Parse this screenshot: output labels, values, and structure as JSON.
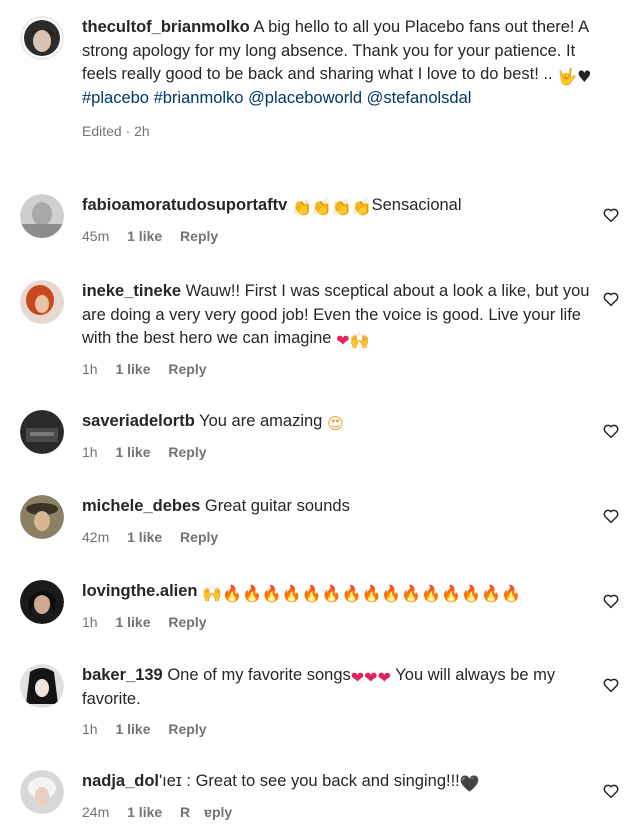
{
  "caption": {
    "username": "thecultof_brianmolko",
    "text": "A big hello to all you Placebo fans out there! A strong apology for my long absence. Thank you for your patience. It feels really good to be back and sharing what I love to do best! ..",
    "emojis": "🤟♥",
    "tags": [
      "#placebo",
      "#brianmolko",
      "@placeboworld",
      "@stefanolsdal"
    ],
    "meta": "Edited · 2h"
  },
  "comments": [
    {
      "username": "fabioamoratudosuportaftv",
      "before": "",
      "emojis": "👏👏👏👏",
      "after": "Sensacional",
      "time": "45m",
      "likes": "1 like",
      "reply": "Reply"
    },
    {
      "username": "ineke_tineke",
      "before": "Wauw!! First I was sceptical about a look a like, but you are doing a very very good job! Even the voice is good. Live your life with the best hero we can imagine",
      "emojis": "❤🙌",
      "after": "",
      "time": "1h",
      "likes": "1 like",
      "reply": "Reply"
    },
    {
      "username": "saveriadelortb",
      "before": "You are amazing",
      "emojis": "😍",
      "after": "",
      "time": "1h",
      "likes": "1 like",
      "reply": "Reply"
    },
    {
      "username": "michele_debes",
      "before": "Great guitar sounds",
      "emojis": "",
      "after": "",
      "time": "42m",
      "likes": "1 like",
      "reply": "Reply"
    },
    {
      "username": "lovingthe.alien",
      "before": "",
      "emojis": "🙌🔥🔥🔥🔥🔥🔥🔥🔥🔥🔥🔥🔥🔥🔥🔥",
      "after": "",
      "time": "1h",
      "likes": "1 like",
      "reply": "Reply"
    },
    {
      "username": "baker_139",
      "before": "One of my favorite songs",
      "emojis": "❤❤❤",
      "after": "You will always be my favorite.",
      "time": "1h",
      "likes": "1 like",
      "reply": "Reply"
    },
    {
      "username": "nadja_dol",
      "username_tail": "'ıeɪ",
      "before": ": Great to see you ba",
      "middle": "ck",
      "after": "and singing!!!",
      "emojis": "🖤",
      "time": "24m",
      "likes": "1 like",
      "reply": "R",
      "reply_tail": "ɐply"
    }
  ],
  "colors": {
    "text": "#262626",
    "secondary": "#737373",
    "link": "#00376b",
    "background": "#ffffff"
  },
  "icons": {
    "like": "heart-outline-icon"
  }
}
